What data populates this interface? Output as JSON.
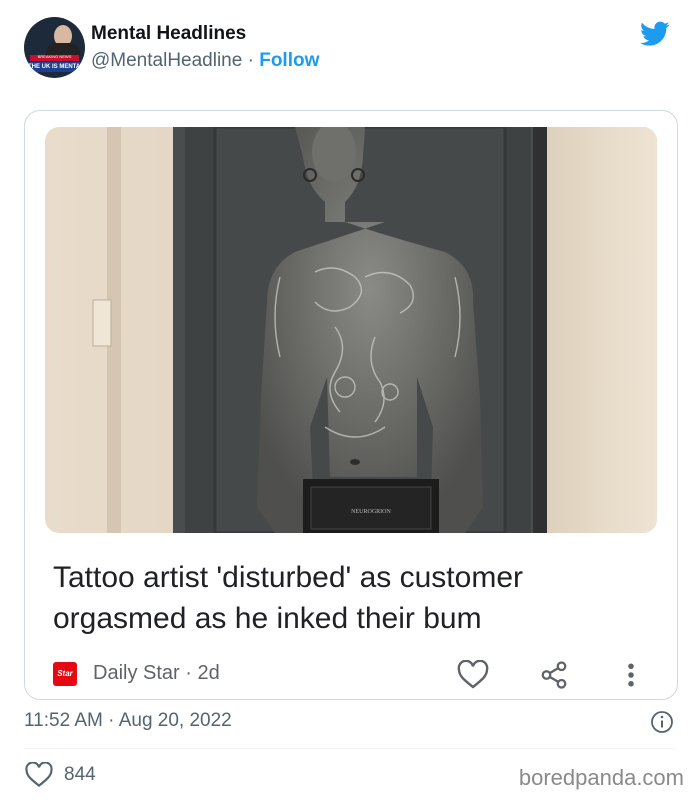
{
  "tweet": {
    "display_name": "Mental Headlines",
    "handle": "@MentalHeadline",
    "separator": " · ",
    "follow_label": "Follow",
    "avatar": {
      "top_text": "BREAKING NEWS",
      "banner_text": "THE UK IS MENTAL"
    },
    "timestamp": "11:52 AM · Aug 20, 2022",
    "like_count": "844"
  },
  "card": {
    "headline": "Tattoo artist 'disturbed' as customer orgasmed as he inked their bum",
    "source_logo_text": "Star",
    "source_meta": "Daily Star · 2d",
    "photo_sign_text": "NEUROGRION"
  },
  "watermark": "boredpanda.com",
  "colors": {
    "twitter_blue": "#1d9bf0",
    "text_secondary": "#536471",
    "daily_star_red": "#e50914",
    "border": "#cfd9de"
  },
  "icons": [
    "twitter-bird-icon",
    "heart-outline-icon",
    "share-icon",
    "more-vertical-icon",
    "info-icon",
    "heart-icon"
  ]
}
